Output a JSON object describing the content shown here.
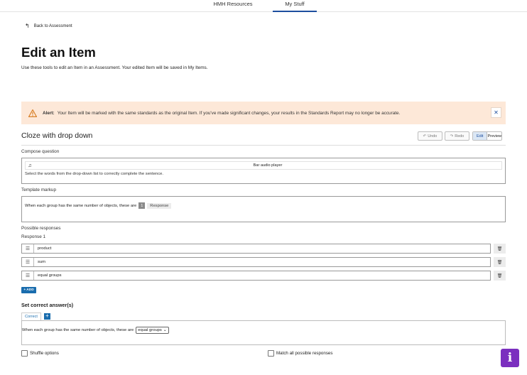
{
  "topnav": {
    "tabs": [
      {
        "label": "HMH Resources",
        "active": false
      },
      {
        "label": "My Stuff",
        "active": true
      }
    ]
  },
  "back": {
    "label": "Back to Assessment"
  },
  "page": {
    "title": "Edit an Item",
    "description": "Use these tools to edit an Item in an Assessment. Your edited Item will be saved in My Items."
  },
  "alert": {
    "heading": "Alert:",
    "message": "Your Item will be marked with the same standards as the original Item. If you've made significant changes, your results in the Standards Report may no longer be accurate.",
    "close_glyph": "✕",
    "color": "#fde8d8"
  },
  "editor": {
    "question_type": "Cloze with drop down",
    "undo_label": "Undo",
    "redo_label": "Redo",
    "edit_label": "Edit",
    "preview_label": "Preview",
    "compose_label": "Compose question",
    "audio_label": "Bar audio player",
    "instructions": "Select the words from the drop-down list to correctly complete the sentence.",
    "template_label": "Template markup",
    "template_text": "When each group has the same number of objects, these are",
    "chip_number": "1",
    "chip_label": "Response",
    "possible_label": "Possible responses",
    "response_group": "Response 1",
    "responses": [
      "product",
      "sum",
      "equal groups"
    ],
    "add_label": "+ ADD",
    "correct_heading": "Set correct answer(s)",
    "correct_tab": "Correct",
    "correct_sentence": "When each group has the same number of objects, these are",
    "correct_selected": "equal groups",
    "shuffle_label": "Shuffle options",
    "match_all_label": "Match all possible responses"
  },
  "accent_color": "#1a6dae",
  "info_button_color": "#7b2fbf"
}
